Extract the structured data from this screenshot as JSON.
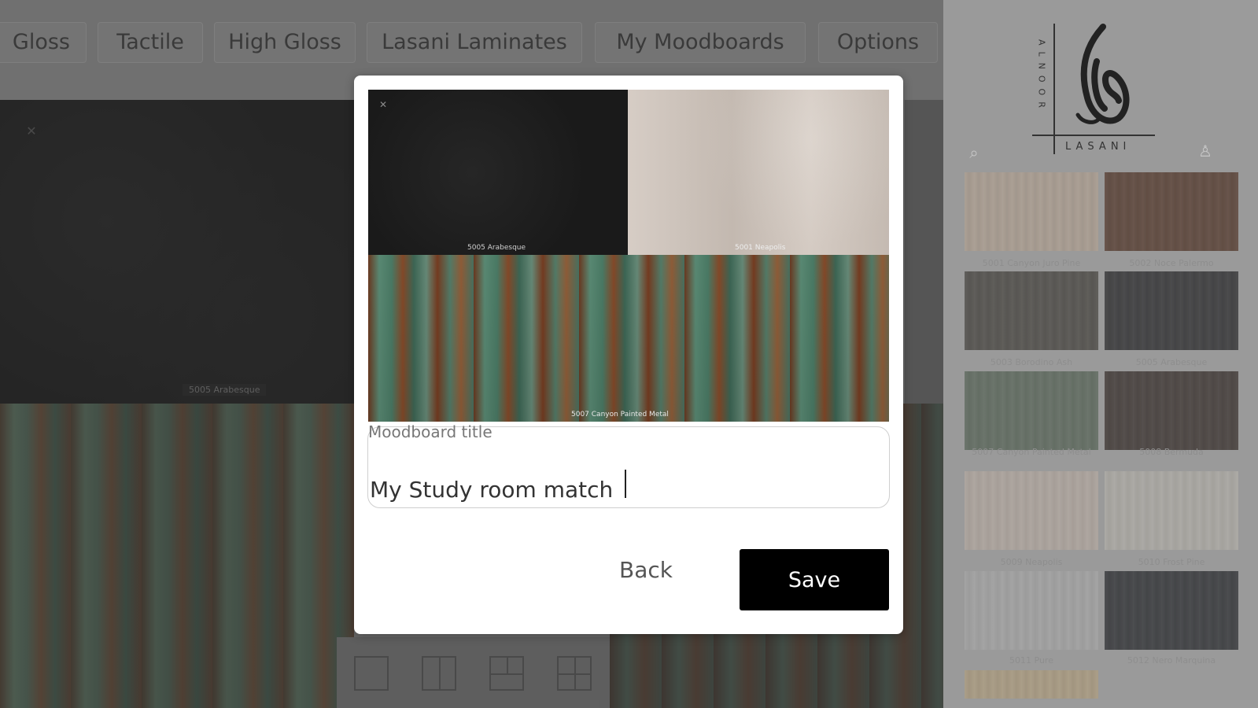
{
  "tabs": [
    "Gloss",
    "Tactile",
    "High Gloss",
    "Lasani Laminates",
    "My Moodboards",
    "Options"
  ],
  "canvas": {
    "dark_caption": "5005 Arabesque"
  },
  "logo": {
    "vertical_text": "ALNOOR",
    "horizontal_text": "LASANI"
  },
  "sidebar": {
    "icons": [
      "search-icon",
      "user-icon"
    ],
    "tiles": [
      {
        "label": "5001 Canyon Juro Pine",
        "color": "#b4a291"
      },
      {
        "label": "5002 Noce Palermo",
        "color": "#4a2a1b"
      },
      {
        "label": "5003 Borodino Ash",
        "color": "#3b3833"
      },
      {
        "label": "5005 Arabesque",
        "color": "#1b1b1d"
      },
      {
        "label": "5007 Canyon Painted Metal",
        "color": "#4f5e4f"
      },
      {
        "label": "5008 Bermuda",
        "color": "#2b211d"
      },
      {
        "label": "5009 Neapolis",
        "color": "#b9ada3"
      },
      {
        "label": "5010 Frost Pine",
        "color": "#b5b2ab"
      },
      {
        "label": "5011 Pure",
        "color": "#a9a9a9"
      },
      {
        "label": "5012 Nero Marquina",
        "color": "#1b1d21"
      },
      {
        "label": "",
        "color": "#b39f7c"
      }
    ]
  },
  "modal": {
    "tile_captions": [
      "5005 Arabesque",
      "5001 Neapolis",
      "5007 Canyon Painted Metal"
    ],
    "field_label": "Moodboard title",
    "title_value": "My Study room match",
    "back_label": "Back",
    "save_label": "Save"
  }
}
